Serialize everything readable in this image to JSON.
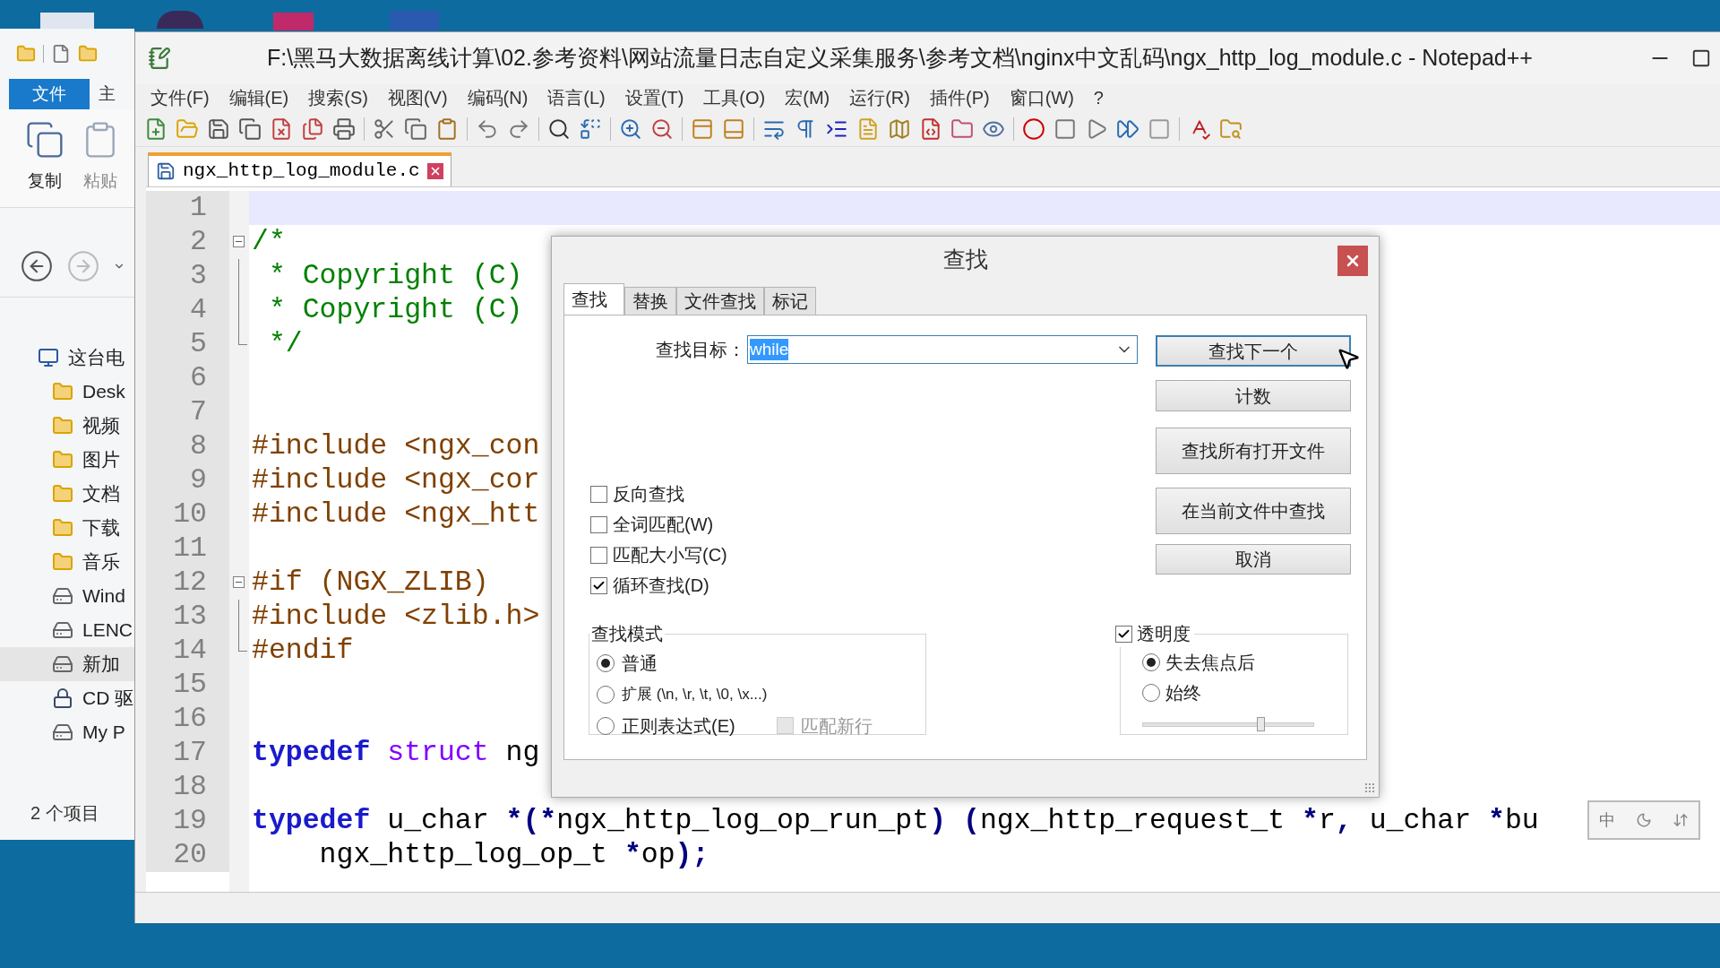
{
  "explorer": {
    "ribbon_tabs": [
      {
        "label": "文件",
        "selected": true
      },
      {
        "label": "主",
        "selected": false
      }
    ],
    "ribbon_buttons": [
      {
        "label": "复制",
        "disabled": false
      },
      {
        "label": "粘贴",
        "disabled": true
      }
    ],
    "tree": [
      {
        "label": "这台电",
        "kind": "pc",
        "selected": false,
        "children": [
          {
            "label": "Desk",
            "kind": "folder",
            "selected": false
          },
          {
            "label": "视频",
            "kind": "folder",
            "selected": false
          },
          {
            "label": "图片",
            "kind": "folder",
            "selected": false
          },
          {
            "label": "文档",
            "kind": "folder",
            "selected": false
          },
          {
            "label": "下载",
            "kind": "folder",
            "selected": false
          },
          {
            "label": "音乐",
            "kind": "folder",
            "selected": false
          },
          {
            "label": "Wind",
            "kind": "drive",
            "selected": false
          },
          {
            "label": "LENC",
            "kind": "drive",
            "selected": false
          },
          {
            "label": "新加",
            "kind": "drive",
            "selected": true
          },
          {
            "label": "CD 驱",
            "kind": "cd",
            "selected": false
          },
          {
            "label": "My P",
            "kind": "drive",
            "selected": false
          }
        ]
      }
    ],
    "status": "2 个项目"
  },
  "notepad": {
    "title": "F:\\黑马大数据离线计算\\02.参考资料\\网站流量日志自定义采集服务\\参考文档\\nginx中文乱码\\ngx_http_log_module.c - Notepad++",
    "menu": [
      "文件(F)",
      "编辑(E)",
      "搜索(S)",
      "视图(V)",
      "编码(N)",
      "语言(L)",
      "设置(T)",
      "工具(O)",
      "宏(M)",
      "运行(R)",
      "插件(P)",
      "窗口(W)",
      "?"
    ],
    "tabs": [
      {
        "label": "ngx_http_log_module.c",
        "selected": true
      }
    ],
    "lines": [
      {
        "number": "1",
        "current": true,
        "kind": "plain"
      },
      {
        "number": "2",
        "current": false,
        "kind": "fold_start",
        "segments": [
          {
            "kind": "comment",
            "text": "/*"
          }
        ]
      },
      {
        "number": "3",
        "current": false,
        "kind": "fold_body",
        "segments": [
          {
            "kind": "comment",
            "text": " * Copyright (C)"
          }
        ]
      },
      {
        "number": "4",
        "current": false,
        "kind": "fold_body",
        "segments": [
          {
            "kind": "comment",
            "text": " * Copyright (C)"
          }
        ]
      },
      {
        "number": "5",
        "current": false,
        "kind": "fold_end",
        "segments": [
          {
            "kind": "comment",
            "text": " */"
          }
        ]
      },
      {
        "number": "6",
        "current": false,
        "kind": "plain"
      },
      {
        "number": "7",
        "current": false,
        "kind": "plain"
      },
      {
        "number": "8",
        "current": false,
        "kind": "plain",
        "segments": [
          {
            "kind": "preproc",
            "text": "#include <ngx_con"
          }
        ]
      },
      {
        "number": "9",
        "current": false,
        "kind": "plain",
        "segments": [
          {
            "kind": "preproc",
            "text": "#include <ngx_cor"
          }
        ]
      },
      {
        "number": "10",
        "current": false,
        "kind": "plain",
        "segments": [
          {
            "kind": "preproc",
            "text": "#include <ngx_htt"
          }
        ]
      },
      {
        "number": "11",
        "current": false,
        "kind": "plain"
      },
      {
        "number": "12",
        "current": false,
        "kind": "fold_start",
        "segments": [
          {
            "kind": "preproc",
            "text": "#if (NGX_ZLIB)"
          }
        ]
      },
      {
        "number": "13",
        "current": false,
        "kind": "fold_body",
        "segments": [
          {
            "kind": "preproc",
            "text": "#include <zlib.h>"
          }
        ]
      },
      {
        "number": "14",
        "current": false,
        "kind": "fold_end",
        "segments": [
          {
            "kind": "preproc",
            "text": "#endif"
          }
        ]
      },
      {
        "number": "15",
        "current": false,
        "kind": "plain"
      },
      {
        "number": "16",
        "current": false,
        "kind": "plain"
      },
      {
        "number": "17",
        "current": false,
        "kind": "plain",
        "segments": [
          {
            "kind": "keyword",
            "text": "typedef"
          },
          {
            "kind": "type",
            "text": " struct"
          },
          {
            "kind": "plain",
            "text": " ng"
          }
        ]
      },
      {
        "number": "18",
        "current": false,
        "kind": "plain"
      },
      {
        "number": "19",
        "current": false,
        "kind": "plain",
        "segments": [
          {
            "kind": "keyword",
            "text": "typedef"
          },
          {
            "kind": "plain",
            "text": " u_char "
          },
          {
            "kind": "operator",
            "text": "*(*"
          },
          {
            "kind": "plain",
            "text": "ngx_http_log_op_run_pt"
          },
          {
            "kind": "operator",
            "text": ") ("
          },
          {
            "kind": "plain",
            "text": "ngx_http_request_t "
          },
          {
            "kind": "operator",
            "text": "*"
          },
          {
            "kind": "plain",
            "text": "r"
          },
          {
            "kind": "operator",
            "text": ","
          },
          {
            "kind": "plain",
            "text": " u_char "
          },
          {
            "kind": "operator",
            "text": "*"
          },
          {
            "kind": "plain",
            "text": "bu"
          }
        ]
      },
      {
        "number": "20",
        "current": false,
        "kind": "plain",
        "segments": [
          {
            "kind": "plain",
            "text": "    ngx_http_log_op_t "
          },
          {
            "kind": "operator",
            "text": "*"
          },
          {
            "kind": "plain",
            "text": "op"
          },
          {
            "kind": "operator",
            "text": ");"
          }
        ]
      }
    ],
    "ime": {
      "label": "中"
    }
  },
  "find_dialog": {
    "title": "查找",
    "tabs": [
      {
        "label": "查找",
        "selected": true
      },
      {
        "label": "替换",
        "selected": false
      },
      {
        "label": "文件查找",
        "selected": false
      },
      {
        "label": "标记",
        "selected": false
      }
    ],
    "target_label": "查找目标：",
    "target_value": "while",
    "buttons": [
      {
        "label": "查找下一个",
        "default": true
      },
      {
        "label": "计数",
        "default": false
      },
      {
        "label": "查找所有打开文件",
        "default": false
      },
      {
        "label": "在当前文件中查找",
        "default": false
      },
      {
        "label": "取消",
        "default": false
      }
    ],
    "options": [
      {
        "label": "反向查找",
        "checked": false
      },
      {
        "label": "全词匹配(W)",
        "checked": false
      },
      {
        "label": "匹配大小写(C)",
        "checked": false
      },
      {
        "label": "循环查找(D)",
        "checked": true
      }
    ],
    "mode": {
      "title": "查找模式",
      "options": [
        {
          "label": "普通",
          "selected": true
        },
        {
          "label": "扩展 (\\n, \\r, \\t, \\0, \\x...)",
          "selected": false
        },
        {
          "label": "正则表达式(E)",
          "selected": false
        }
      ],
      "multiline": {
        "label": "匹配新行",
        "checked": false,
        "disabled": true
      }
    },
    "transparency": {
      "label": "透明度",
      "checked": true,
      "options": [
        {
          "label": "失去焦点后",
          "selected": true
        },
        {
          "label": "始终",
          "selected": false
        }
      ],
      "level": 0.7
    }
  }
}
